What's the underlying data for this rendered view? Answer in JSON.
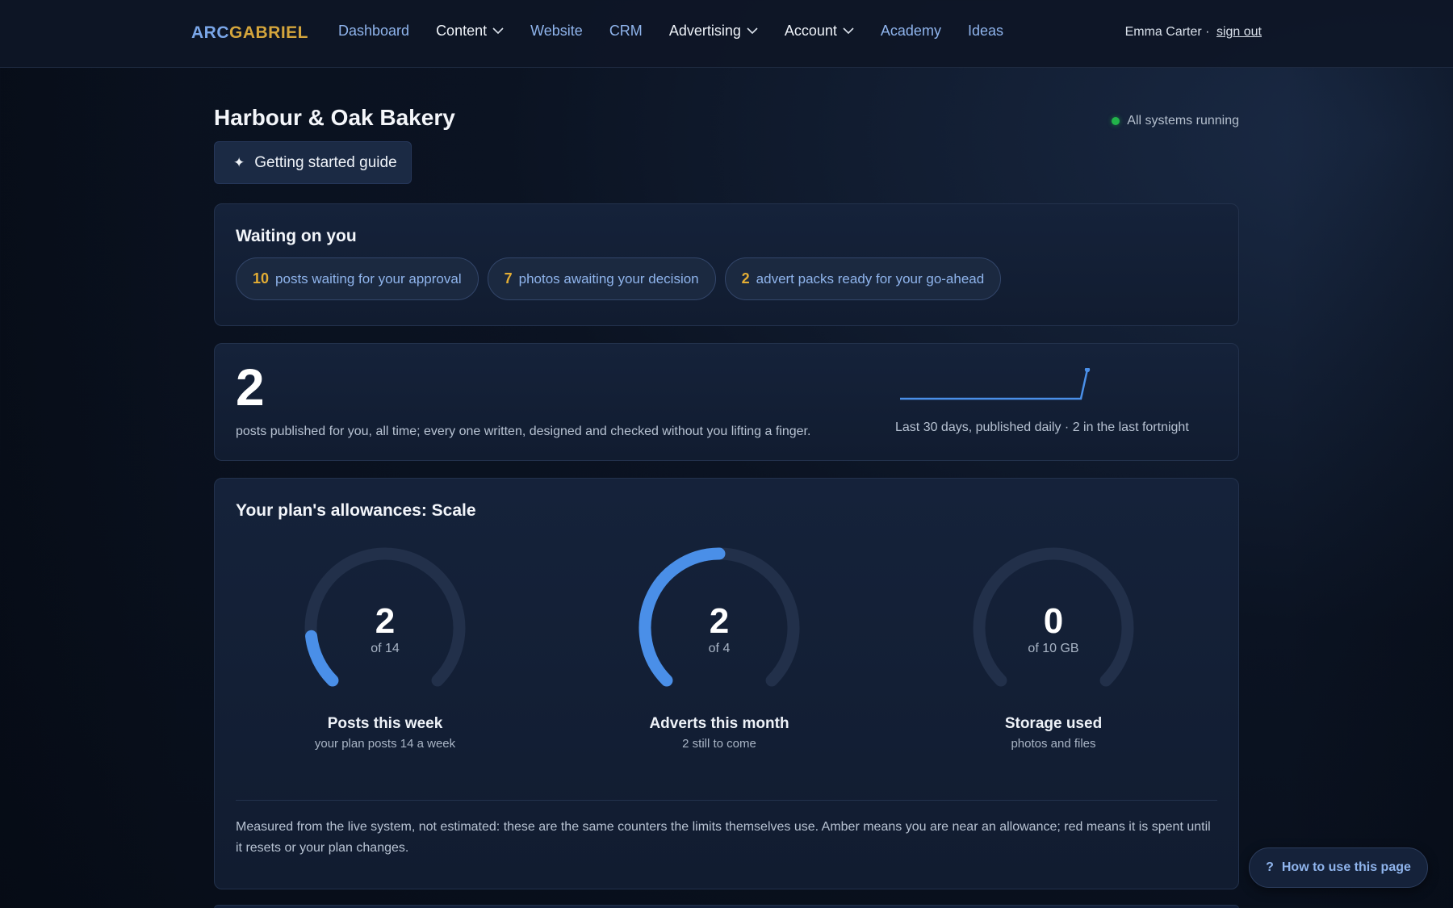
{
  "nav": {
    "brand_a": "ARC",
    "brand_b": "GABRIEL",
    "links": [
      {
        "label": "Dashboard",
        "dropdown": false
      },
      {
        "label": "Content",
        "dropdown": true
      },
      {
        "label": "Website",
        "dropdown": false
      },
      {
        "label": "CRM",
        "dropdown": false
      },
      {
        "label": "Advertising",
        "dropdown": true
      },
      {
        "label": "Account",
        "dropdown": true
      },
      {
        "label": "Academy",
        "dropdown": false
      },
      {
        "label": "Ideas",
        "dropdown": false
      }
    ],
    "user_name": "Emma Carter ·",
    "sign_out": "sign out"
  },
  "header": {
    "title": "Harbour & Oak Bakery",
    "status_text": "All systems running",
    "guide_button": "Getting started guide"
  },
  "waiting": {
    "title": "Waiting on you",
    "pills": [
      {
        "count": "10",
        "text": "posts waiting for your approval"
      },
      {
        "count": "7",
        "text": "photos awaiting your decision"
      },
      {
        "count": "2",
        "text": "advert packs ready for your go-ahead"
      }
    ]
  },
  "published": {
    "count": "2",
    "description": "posts published for you, all time; every one written, designed and checked without you lifting a finger.",
    "sparkline_caption": "Last 30 days, published daily · 2 in the last fortnight"
  },
  "chart_data": {
    "type": "line",
    "title": "",
    "x": [
      1,
      2,
      3,
      4,
      5,
      6,
      7,
      8,
      9,
      10,
      11,
      12,
      13,
      14,
      15,
      16,
      17,
      18,
      19,
      20,
      21,
      22,
      23,
      24,
      25,
      26,
      27,
      28,
      29,
      30
    ],
    "values": [
      0,
      0,
      0,
      0,
      0,
      0,
      0,
      0,
      0,
      0,
      0,
      0,
      0,
      0,
      0,
      0,
      0,
      0,
      0,
      0,
      0,
      0,
      0,
      0,
      0,
      0,
      0,
      0,
      0,
      2
    ],
    "ylim": [
      0,
      2
    ]
  },
  "allowances": {
    "title": "Your plan's allowances: Scale",
    "gauges": [
      {
        "value": "2",
        "of": "of 14",
        "fraction": 0.1429,
        "title": "Posts this week",
        "sub": "your plan posts 14 a week"
      },
      {
        "value": "2",
        "of": "of 4",
        "fraction": 0.5,
        "title": "Adverts this month",
        "sub": "2 still to come"
      },
      {
        "value": "0",
        "of": "of 10 GB",
        "fraction": 0,
        "title": "Storage used",
        "sub": "photos and files"
      }
    ],
    "note": "Measured from the live system, not estimated: these are the same counters the limits themselves use. Amber means you are near an allowance; red means it is spent until it resets or your plan changes."
  },
  "help_button": "How to use this page",
  "colors": {
    "accent": "#4a8fe8",
    "amber": "#e3ad34",
    "status_green": "#22b34a",
    "link": "#8fb4ec"
  }
}
